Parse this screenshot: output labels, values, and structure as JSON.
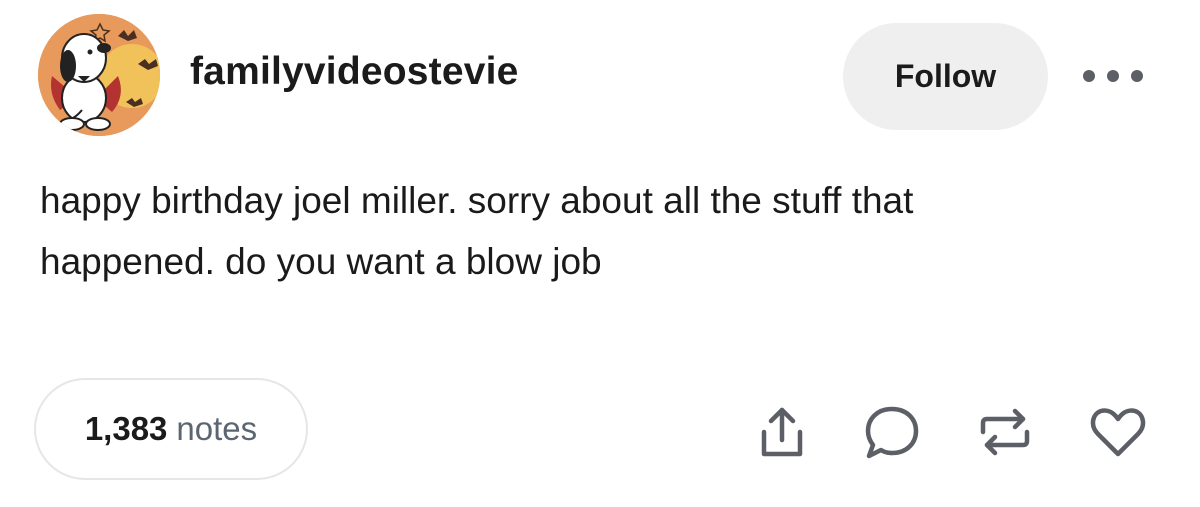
{
  "post": {
    "username": "familyvideostevie",
    "follow_label": "Follow",
    "body_lines": [
      "happy birthday joel miller. sorry about all the stuff that",
      "happened. do you want a blow job"
    ]
  },
  "footer": {
    "notes_count": "1,383",
    "notes_label": "notes",
    "actions": [
      "share-icon",
      "reply-icon",
      "reblog-icon",
      "like-icon"
    ]
  },
  "colors": {
    "avatar_bg": "#e79a5c",
    "button_bg": "#efefef",
    "icon": "#5c5f66",
    "muted_text": "#5c6670"
  }
}
